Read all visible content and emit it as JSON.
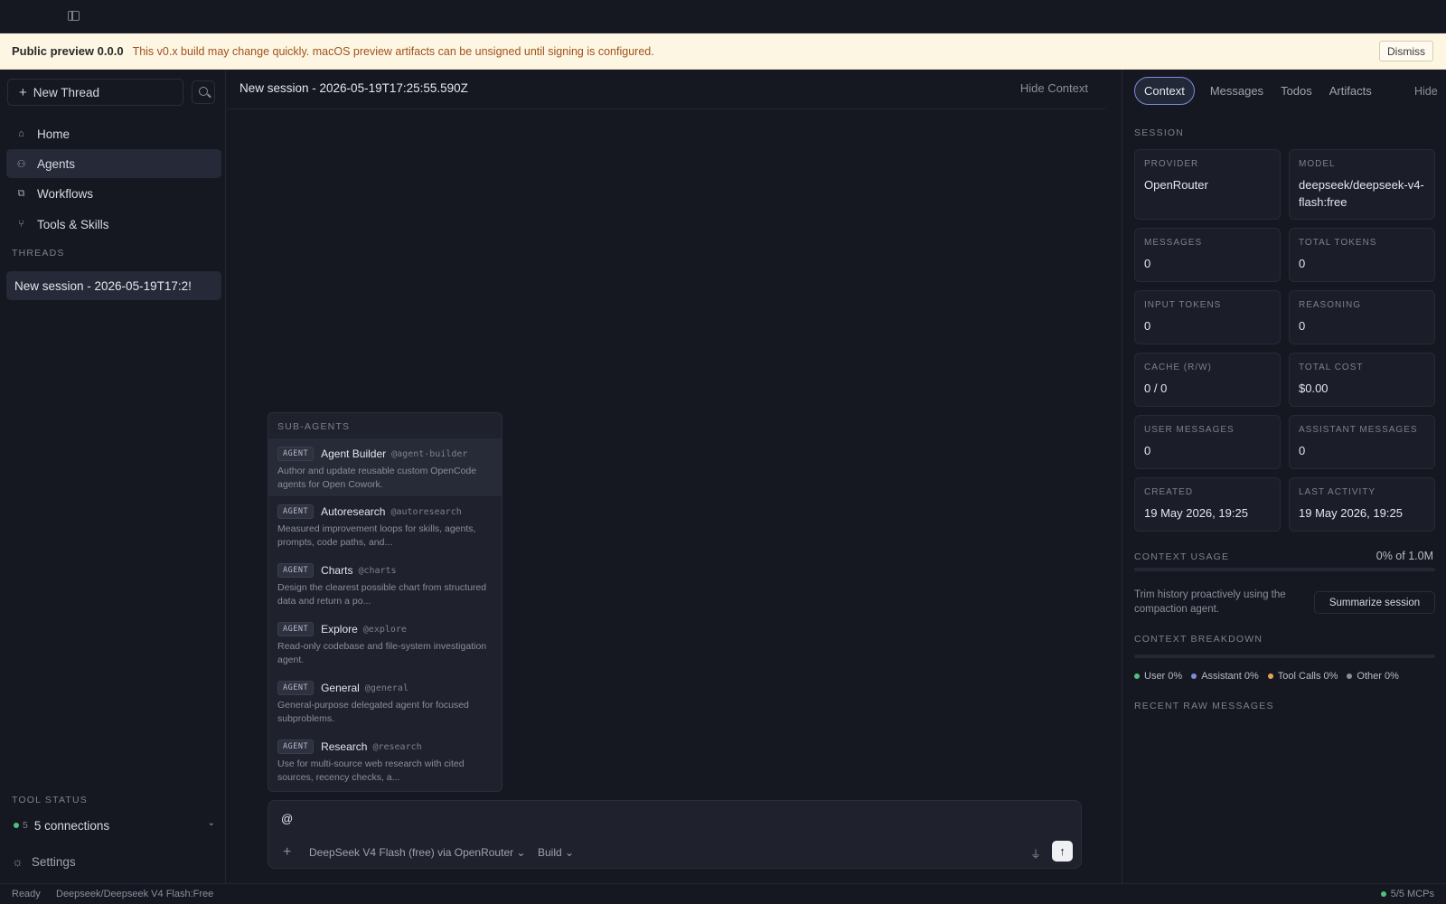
{
  "banner": {
    "title": "Public preview 0.0.0",
    "message": "This v0.x build may change quickly. macOS preview artifacts can be unsigned until signing is configured.",
    "dismiss_label": "Dismiss"
  },
  "sidebar": {
    "new_thread_label": "New Thread",
    "nav": [
      {
        "label": "Home",
        "icon": "home-icon"
      },
      {
        "label": "Agents",
        "icon": "agents-icon"
      },
      {
        "label": "Workflows",
        "icon": "workflows-icon"
      },
      {
        "label": "Tools & Skills",
        "icon": "tools-icon"
      }
    ],
    "threads_label": "THREADS",
    "threads": [
      {
        "label": "New session - 2026-05-19T17:2!"
      }
    ],
    "tool_status_label": "TOOL STATUS",
    "tool_status_count": "5",
    "tool_status_connections": "5 connections",
    "settings_label": "Settings"
  },
  "main": {
    "title": "New session - 2026-05-19T17:25:55.590Z",
    "hide_context_label": "Hide Context"
  },
  "subagents": {
    "header": "SUB-AGENTS",
    "badge": "AGENT",
    "items": [
      {
        "name": "Agent Builder",
        "handle": "@agent-builder",
        "desc": "Author and update reusable custom OpenCode agents for Open Cowork."
      },
      {
        "name": "Autoresearch",
        "handle": "@autoresearch",
        "desc": "Measured improvement loops for skills, agents, prompts, code paths, and..."
      },
      {
        "name": "Charts",
        "handle": "@charts",
        "desc": "Design the clearest possible chart from structured data and return a po..."
      },
      {
        "name": "Explore",
        "handle": "@explore",
        "desc": "Read-only codebase and file-system investigation agent."
      },
      {
        "name": "General",
        "handle": "@general",
        "desc": "General-purpose delegated agent for focused subproblems."
      },
      {
        "name": "Research",
        "handle": "@research",
        "desc": "Use for multi-source web research with cited sources, recency checks, a..."
      }
    ]
  },
  "composer": {
    "input_value": "@",
    "model_label": "DeepSeek V4 Flash (free) via OpenRouter",
    "mode_label": "Build"
  },
  "context_panel": {
    "tabs": [
      "Context",
      "Messages",
      "Todos",
      "Artifacts"
    ],
    "hide_label": "Hide",
    "session_label": "SESSION",
    "cards": [
      {
        "key": "PROVIDER",
        "value": "OpenRouter"
      },
      {
        "key": "MODEL",
        "value": "deepseek/deepseek-v4-flash:free"
      },
      {
        "key": "MESSAGES",
        "value": "0"
      },
      {
        "key": "TOTAL TOKENS",
        "value": "0"
      },
      {
        "key": "INPUT TOKENS",
        "value": "0"
      },
      {
        "key": "REASONING",
        "value": "0"
      },
      {
        "key": "CACHE (R/W)",
        "value": "0 / 0"
      },
      {
        "key": "TOTAL COST",
        "value": "$0.00"
      },
      {
        "key": "USER MESSAGES",
        "value": "0"
      },
      {
        "key": "ASSISTANT MESSAGES",
        "value": "0"
      },
      {
        "key": "CREATED",
        "value": "19 May 2026, 19:25"
      },
      {
        "key": "LAST ACTIVITY",
        "value": "19 May 2026, 19:25"
      }
    ],
    "context_usage_label": "CONTEXT USAGE",
    "context_usage_value": "0% of 1.0M",
    "trim_text": "Trim history proactively using the compaction agent.",
    "summarize_label": "Summarize session",
    "breakdown_label": "CONTEXT BREAKDOWN",
    "legend": [
      {
        "label": "User 0%",
        "color": "#4ec27a"
      },
      {
        "label": "Assistant 0%",
        "color": "#7f8bdc"
      },
      {
        "label": "Tool Calls 0%",
        "color": "#e8a15a"
      },
      {
        "label": "Other 0%",
        "color": "#8a8e9c"
      }
    ],
    "recent_label": "RECENT RAW MESSAGES"
  },
  "statusbar": {
    "ready": "Ready",
    "model": "Deepseek/Deepseek V4 Flash:Free",
    "mcps": "5/5 MCPs"
  }
}
